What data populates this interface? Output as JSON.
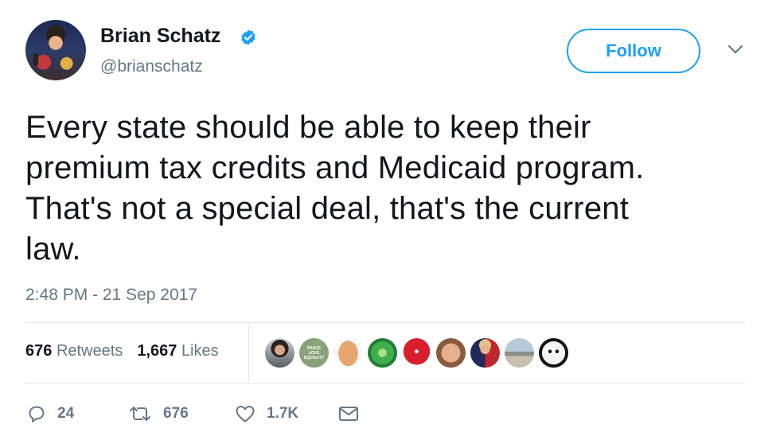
{
  "author": {
    "name": "Brian Schatz",
    "handle": "@brianschatz",
    "verified": true
  },
  "follow_label": "Follow",
  "tweet": {
    "text_lines": [
      "Every state should be able to keep their",
      "premium tax credits and Medicaid program.",
      "That's not a special deal, that's the current",
      "law."
    ],
    "timestamp": "2:48 PM - 21 Sep 2017"
  },
  "stats": {
    "retweets_count": "676",
    "retweets_label": "Retweets",
    "likes_count": "1,667",
    "likes_label": "Likes"
  },
  "liker_avatars": [
    "avatar-woman-dark-hair",
    "avatar-peace-love-equality",
    "avatar-egg",
    "avatar-green-circle",
    "avatar-red-rose",
    "avatar-bald-man",
    "avatar-man-suit-flag",
    "avatar-landscape",
    "avatar-cartoon-face"
  ],
  "liker_badge_text": "PEACE LOVE EQUALITY",
  "actions": {
    "reply_count": "24",
    "retweet_count": "676",
    "like_count": "1.7K"
  },
  "colors": {
    "accent": "#1da1f2",
    "secondary_text": "#657786",
    "primary_text": "#14171a",
    "divider": "#e1e8ed"
  }
}
